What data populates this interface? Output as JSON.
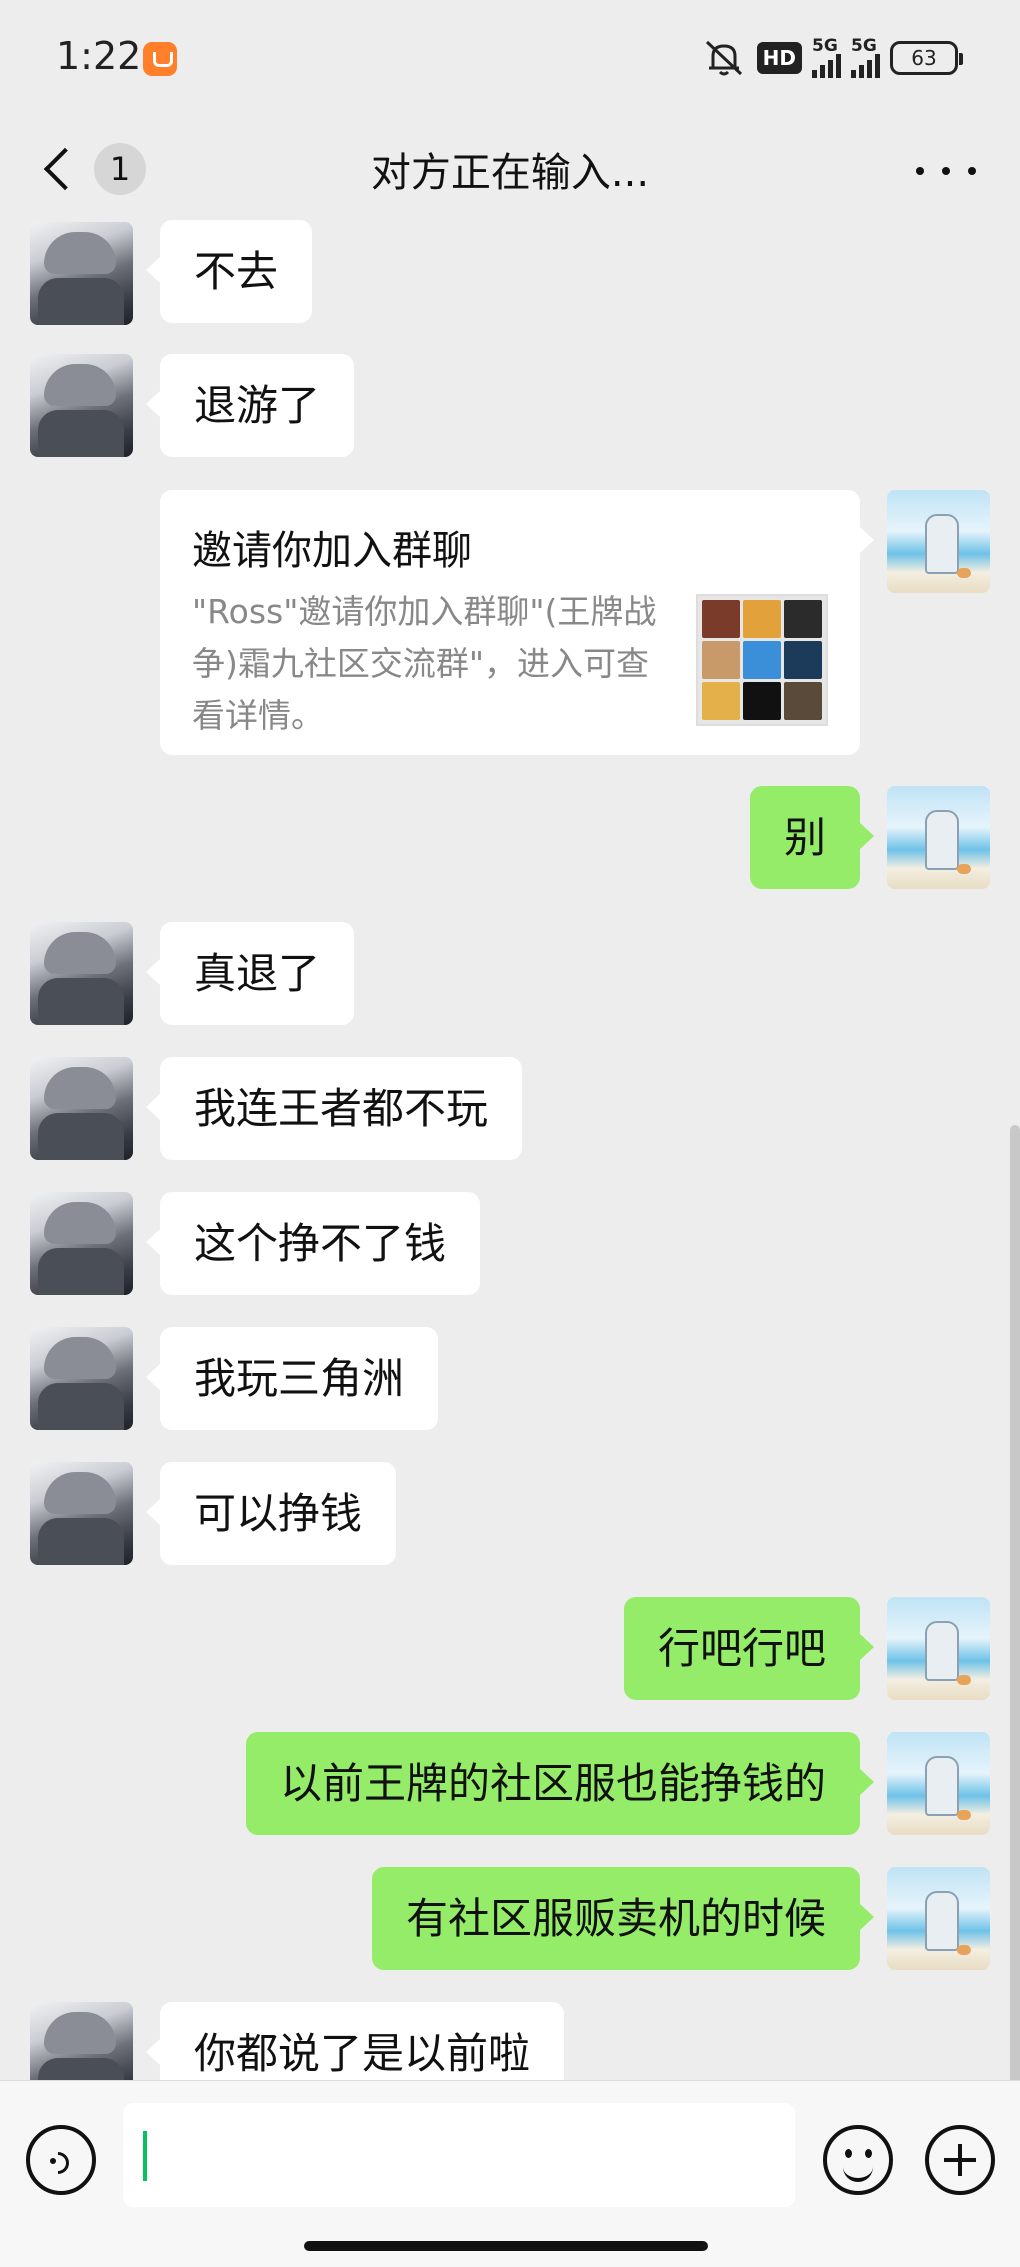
{
  "status_bar": {
    "time": "1:22",
    "hd_label": "HD",
    "sim1_label": "5G",
    "sim2_label": "5G",
    "battery": "63"
  },
  "header": {
    "unread_count": "1",
    "title": "对方正在输入..."
  },
  "messages": [
    {
      "side": "left",
      "text": "不去"
    },
    {
      "side": "left",
      "text": "退游了"
    },
    {
      "side": "right",
      "type": "card",
      "title": "邀请你加入群聊",
      "desc": "\"Ross\"邀请你加入群聊\"(王牌战争)霜九社区交流群\"，进入可查看详情。"
    },
    {
      "side": "right",
      "text": "别"
    },
    {
      "side": "left",
      "text": "真退了"
    },
    {
      "side": "left",
      "text": "我连王者都不玩"
    },
    {
      "side": "left",
      "text": "这个挣不了钱"
    },
    {
      "side": "left",
      "text": "我玩三角洲"
    },
    {
      "side": "left",
      "text": "可以挣钱"
    },
    {
      "side": "right",
      "text": "行吧行吧"
    },
    {
      "side": "right",
      "text": "以前王牌的社区服也能挣钱的"
    },
    {
      "side": "right",
      "text": "有社区服贩卖机的时候"
    },
    {
      "side": "left",
      "text": "你都说了是以前啦"
    }
  ],
  "colors": {
    "background": "#ededed",
    "self_bubble": "#95ec69",
    "other_bubble": "#ffffff",
    "caret": "#07c160"
  },
  "icons": [
    "back-chevron-icon",
    "more-icon",
    "voice-icon",
    "emoji-icon",
    "plus-icon",
    "mute-icon",
    "battery-icon"
  ]
}
